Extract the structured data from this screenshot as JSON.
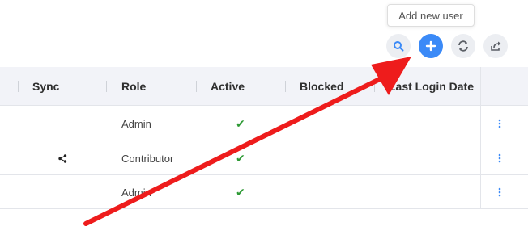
{
  "tooltip": {
    "text": "Add new user"
  },
  "toolbar": {
    "search_icon": "search-icon",
    "add_icon": "plus-icon",
    "refresh_icon": "refresh-icon",
    "export_icon": "share-icon",
    "primary_color": "#3b8af7"
  },
  "table": {
    "columns": [
      "Sync",
      "Role",
      "Active",
      "Blocked",
      "Last Login Date"
    ],
    "rows": [
      {
        "sync": "",
        "role": "Admin",
        "active": "✔",
        "blocked": "",
        "last_login": ""
      },
      {
        "sync": "share-icon",
        "role": "Contributor",
        "active": "✔",
        "blocked": "",
        "last_login": ""
      },
      {
        "sync": "",
        "role": "Admin",
        "active": "✔",
        "blocked": "",
        "last_login": ""
      }
    ],
    "check_color": "#2e9a35",
    "menu_color": "#3b8af7"
  },
  "annotation": {
    "arrow_color": "#ee1c1c"
  }
}
